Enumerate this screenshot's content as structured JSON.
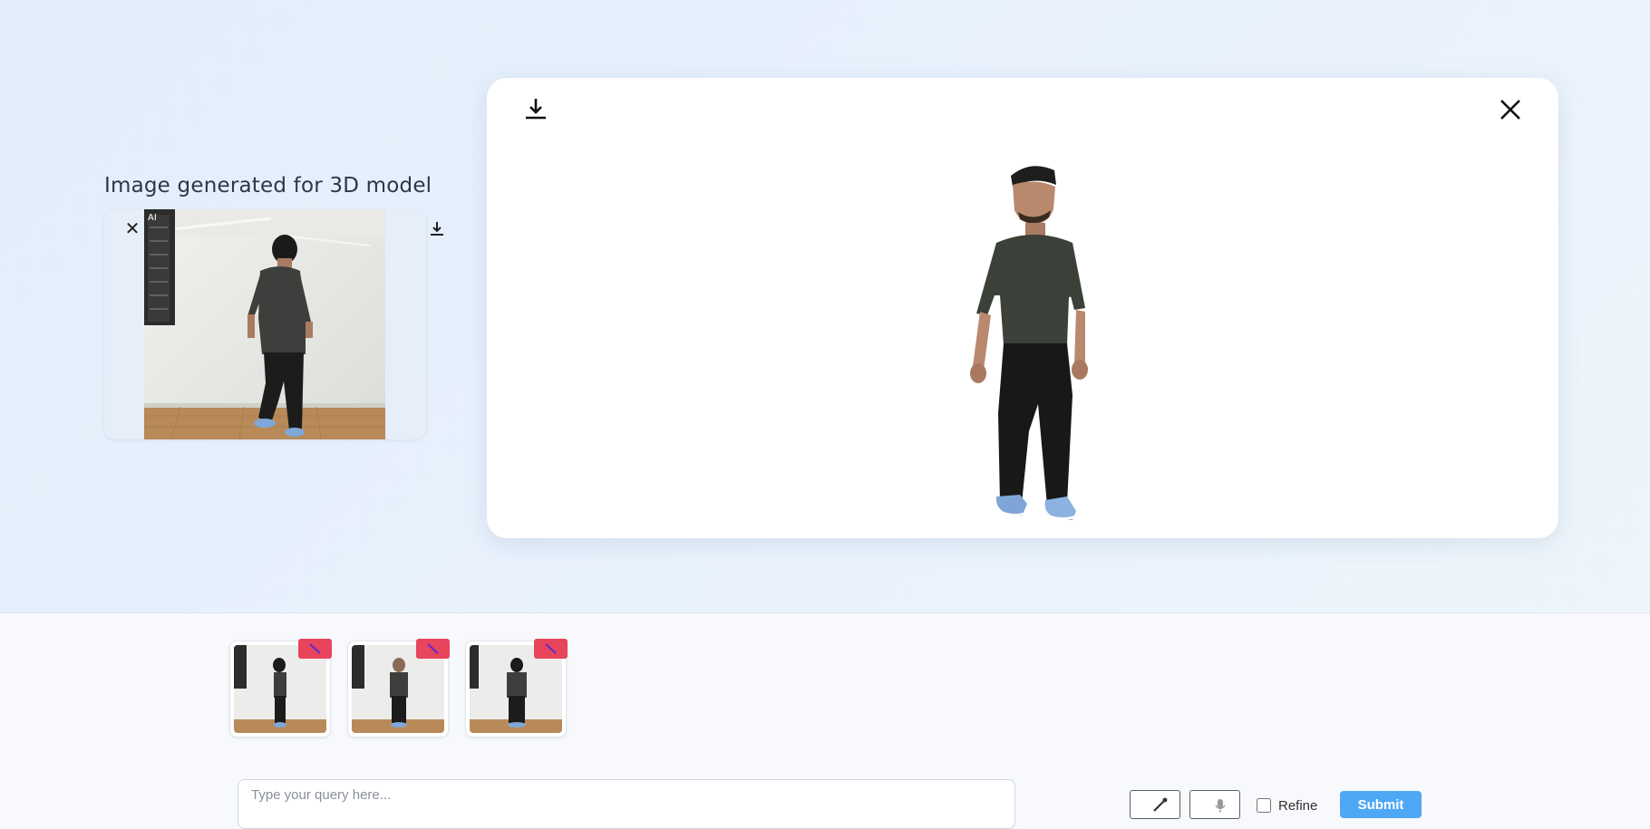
{
  "generated": {
    "title": "Image generated for 3D model",
    "photo_label": "AI"
  },
  "query": {
    "placeholder": "Type your query here...",
    "value": ""
  },
  "controls": {
    "refine_label": "Refine",
    "refine_checked": false,
    "submit_label": "Submit"
  },
  "icons": {
    "download": "download-icon",
    "close": "close-icon",
    "wand": "magic-wand-icon",
    "mic": "microphone-icon",
    "remove": "remove-icon"
  },
  "colors": {
    "accent": "#4fa8f5",
    "remove_badge": "#e8445c",
    "shirt": "#3b4038",
    "pants": "#1a1a1a",
    "shoes": "#7fa5d6",
    "skin": "#b88a70"
  }
}
